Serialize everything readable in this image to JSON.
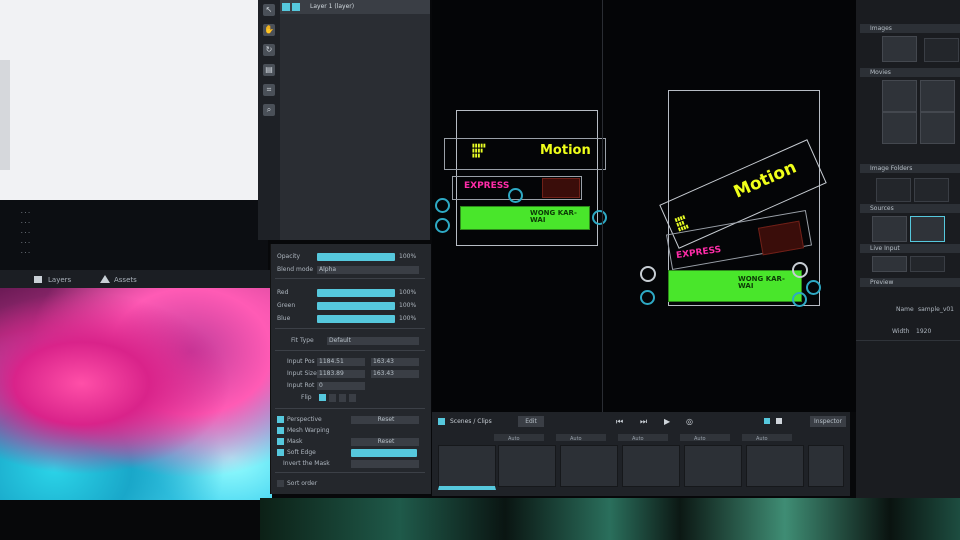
{
  "console": {
    "lines": [
      "...",
      "...",
      "...",
      "...",
      "..."
    ]
  },
  "tabs": {
    "layers_label": "Layers",
    "assets_label": "Assets"
  },
  "layer_panel": {
    "selected_layer": "Layer 1 (layer)"
  },
  "props": {
    "opacity_label": "Opacity",
    "opacity_value": "100%",
    "blend_label": "Blend mode",
    "blend_value": "Alpha",
    "red_label": "Red",
    "green_label": "Green",
    "blue_label": "Blue",
    "red_value": "100%",
    "green_value": "100%",
    "blue_value": "100%",
    "fit_label": "Fit Type",
    "fit_value": "Default",
    "input_pos_label": "Input Pos",
    "input_pos_x": "1184.51",
    "input_pos_y": "163.43",
    "input_size_label": "Input Size",
    "input_size_x": "1183.89",
    "input_size_y": "163.43",
    "input_rot_label": "Input Rot",
    "input_rot_value": "0",
    "flip_label": "Flip",
    "perspective_label": "Perspective",
    "perspective_btn": "Reset",
    "mesh_warp_label": "Mesh Warping",
    "mask_label": "Mask",
    "mask_btn": "Reset",
    "soft_edge_label": "Soft Edge",
    "invert_mask_label": "Invert the Mask",
    "sort_label": "Sort order"
  },
  "canvas": {
    "motion_left": "Motion",
    "motion_right": "Motion",
    "express_left": "EXPRESS",
    "express_right": "EXPRESS",
    "wong_left": "WONG KAR-WAI",
    "wong_right": "WONG KAR-WAI"
  },
  "timeline": {
    "title": "Scenes / Clips",
    "edit_btn": "Edit",
    "inspector_btn": "Inspector",
    "cell_label": "Auto"
  },
  "right_panel": {
    "images": "Images",
    "movies": "Movies",
    "image_folders": "Image Folders",
    "sources": "Sources",
    "live_input": "Live Input",
    "preview": "Preview",
    "name_label": "Name",
    "name_value": "sample_v01",
    "width_label": "Width",
    "width_value": "1920"
  },
  "colors": {
    "accent": "#56c8dd",
    "motion": "#f0ff1a",
    "express": "#ff2ca8",
    "green": "#49e62b"
  }
}
